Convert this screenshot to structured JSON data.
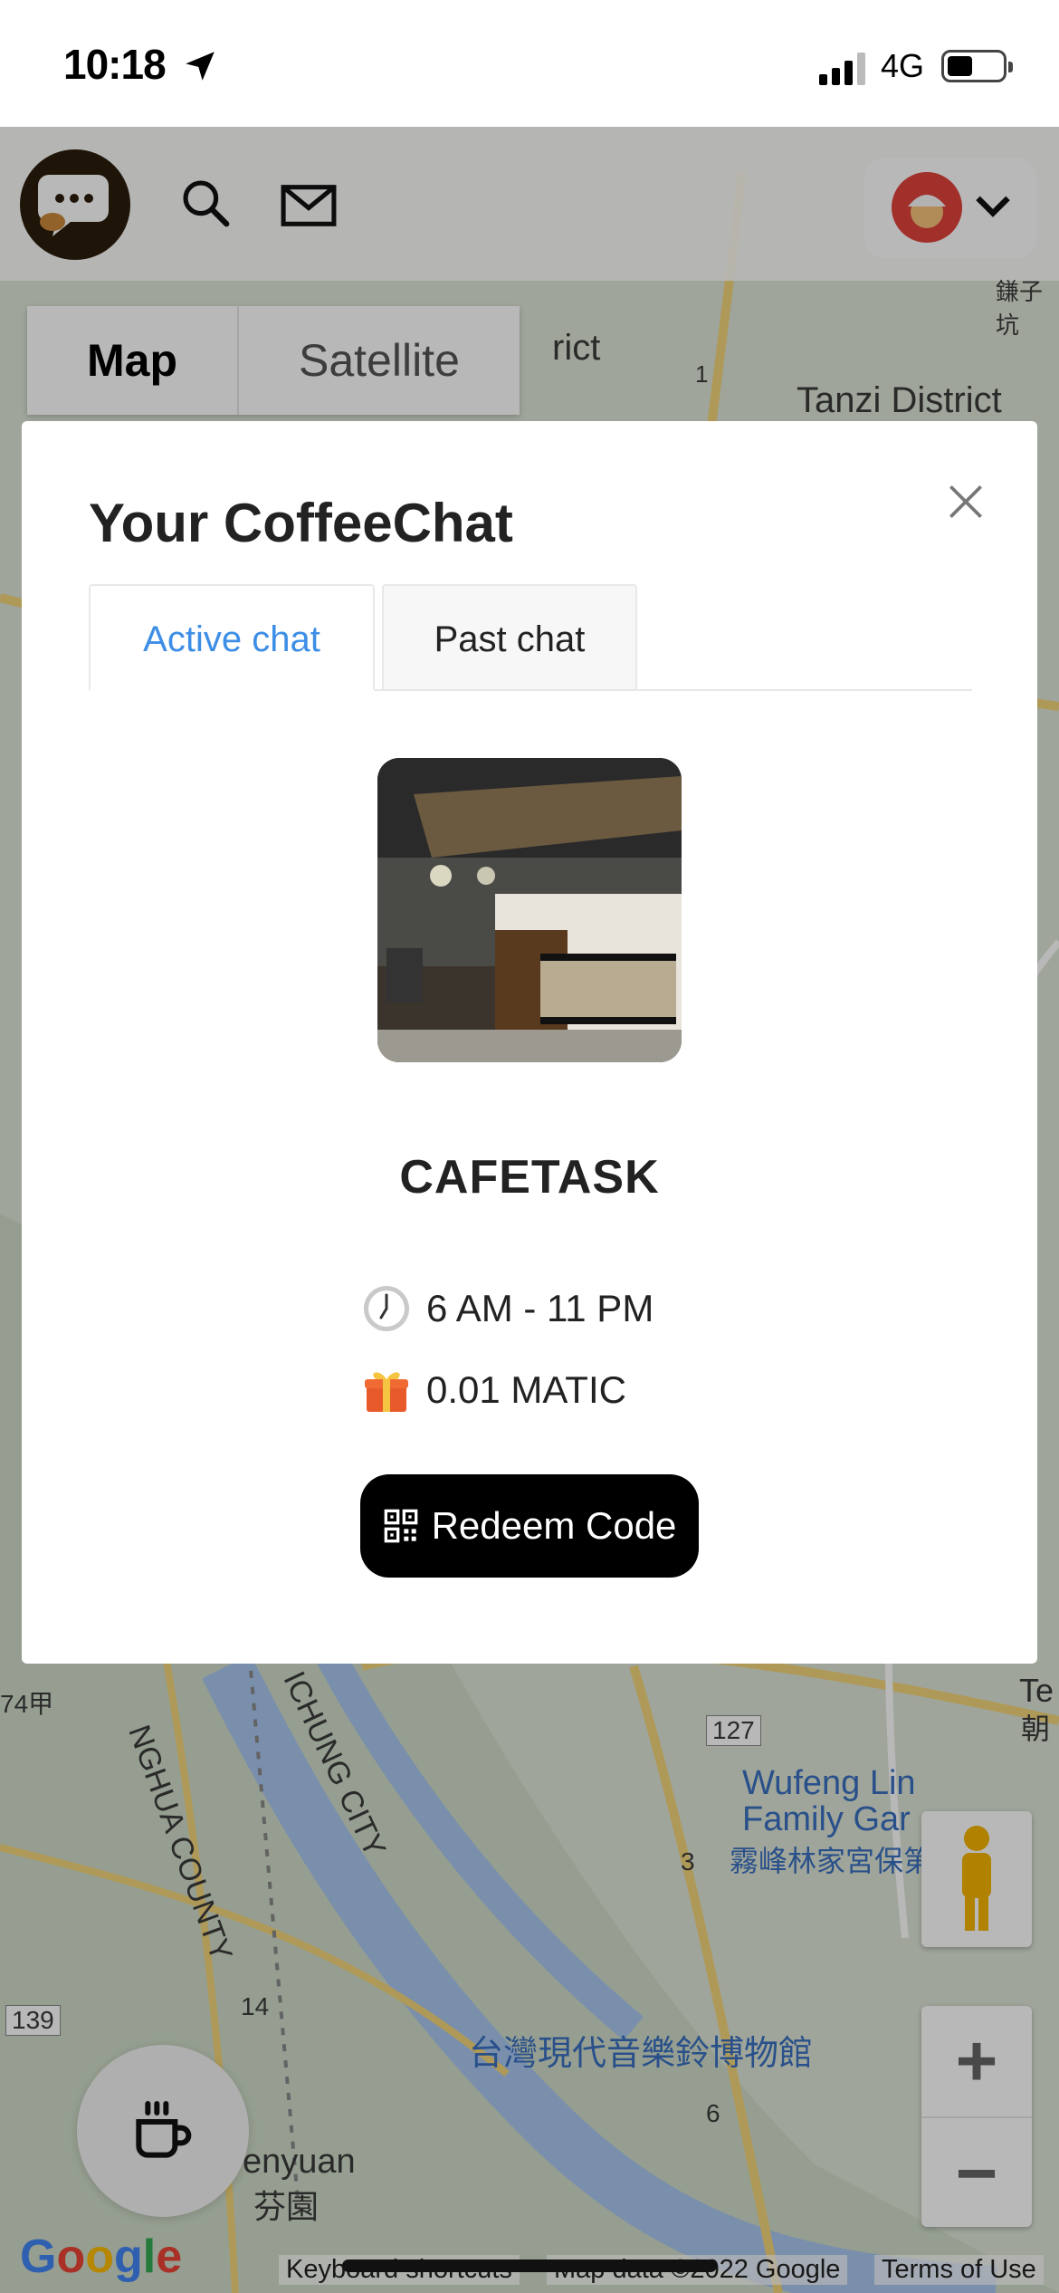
{
  "status": {
    "time": "10:18",
    "network": "4G",
    "battery_level": 0.45
  },
  "map": {
    "type_buttons": {
      "map": "Map",
      "satellite": "Satellite"
    },
    "labels": {
      "tanzi": "Tanzi District",
      "rict": "rict",
      "wufeng": "Wufeng Lin",
      "family": "Family Gar",
      "wufeng_cn": "霧峰林家宮保第",
      "museum_cn": "台灣現代音樂鈴博物館",
      "changhua": "NGHUA COUNTY",
      "chung": "ICHUNG CITY",
      "enyuan": "enyuan",
      "fenyuan_cn": "芬園",
      "road_127": "127",
      "road_139": "139",
      "road_14": "14",
      "road_3": "3",
      "road_6": "6",
      "road_1": "1",
      "km74": "74甲",
      "te": "Te",
      "chao": "朝",
      "top_cn": "鎌子坑"
    },
    "attribution": {
      "google": "Google",
      "keyboard": "Keyboard shortcuts",
      "map_data": "Map data ©2022 Google",
      "terms": "Terms of Use"
    },
    "zoom": {
      "in": "+",
      "out": "−"
    }
  },
  "modal": {
    "title": "Your CoffeeChat",
    "tabs": {
      "active": "Active chat",
      "past": "Past chat"
    },
    "shop_name": "CAFETASK",
    "hours": "6 AM - 11 PM",
    "reward": "0.01 MATIC",
    "redeem_label": "Redeem Code"
  },
  "colors": {
    "accent": "#3d8ee6",
    "button": "#000000",
    "logo_bg": "#2c1c0c"
  }
}
